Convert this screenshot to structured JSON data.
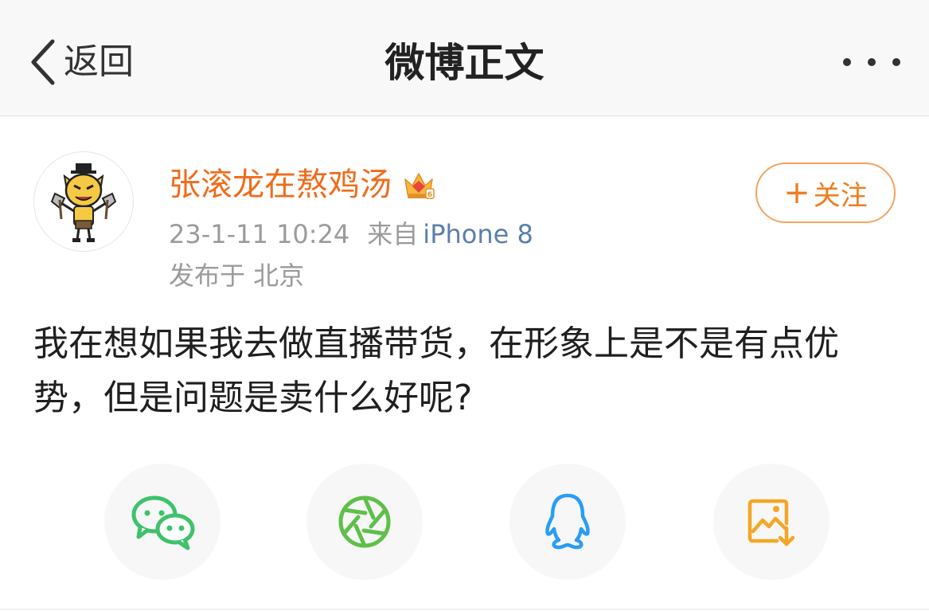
{
  "nav": {
    "back_label": "返回",
    "title": "微博正文"
  },
  "post": {
    "username": "张滚龙在熬鸡汤",
    "time": "23-1-11 10:24",
    "from_label": "来自",
    "device": "iPhone 8",
    "location": "发布于 北京",
    "follow_label": "关注",
    "content": "我在想如果我去做直播带货，在形象上是不是有点优势，但是问题是卖什么好呢?"
  },
  "share": {
    "items": [
      {
        "icon": "wechat-icon",
        "color": "#3ec26b"
      },
      {
        "icon": "moments-icon",
        "color": "#5fbf4a"
      },
      {
        "icon": "qq-icon",
        "color": "#2a9df4"
      },
      {
        "icon": "save-image-icon",
        "color": "#f5a623"
      }
    ]
  },
  "colors": {
    "username": "#f06b1a",
    "device_link": "#5b7fab",
    "follow": "#f07d1e"
  }
}
